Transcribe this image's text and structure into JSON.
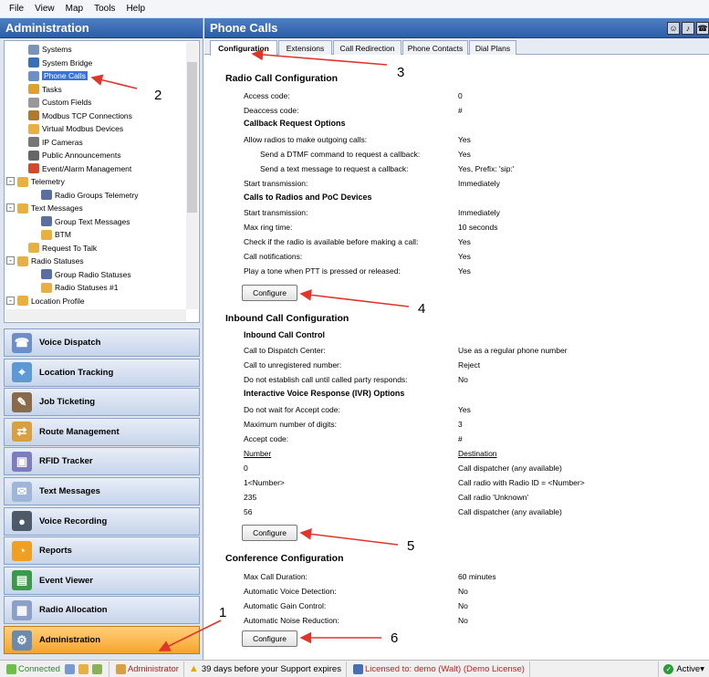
{
  "menu": [
    "File",
    "View",
    "Map",
    "Tools",
    "Help"
  ],
  "left_header": "Administration",
  "tree": [
    {
      "label": "Systems",
      "icon": "systems-icon",
      "color": "#7a93b8",
      "indent": 1
    },
    {
      "label": "System Bridge",
      "icon": "bridge-icon",
      "color": "#3a6fb5",
      "indent": 1
    },
    {
      "label": "Phone Calls",
      "icon": "phone-calls-icon",
      "color": "#6d8fc7",
      "indent": 1,
      "selected": true
    },
    {
      "label": "Tasks",
      "icon": "tasks-icon",
      "color": "#e0a030",
      "indent": 1
    },
    {
      "label": "Custom Fields",
      "icon": "custom-fields-icon",
      "color": "#999",
      "indent": 1
    },
    {
      "label": "Modbus TCP Connections",
      "icon": "modbus-icon",
      "color": "#b07a2a",
      "indent": 1
    },
    {
      "label": "Virtual Modbus Devices",
      "icon": "virtual-modbus-icon",
      "color": "#e8b040",
      "indent": 1
    },
    {
      "label": "IP Cameras",
      "icon": "camera-icon",
      "color": "#777",
      "indent": 1
    },
    {
      "label": "Public Announcements",
      "icon": "speaker-icon",
      "color": "#666",
      "indent": 1
    },
    {
      "label": "Event/Alarm Management",
      "icon": "alarm-icon",
      "color": "#d24a2a",
      "indent": 1
    },
    {
      "label": "Telemetry",
      "icon": "folder-icon",
      "color": "#e8b040",
      "indent": 0,
      "expander": "-"
    },
    {
      "label": "Radio Groups Telemetry",
      "icon": "table-icon",
      "color": "#5a6fa0",
      "indent": 2
    },
    {
      "label": "Text Messages",
      "icon": "folder-icon",
      "color": "#e8b040",
      "indent": 0,
      "expander": "-"
    },
    {
      "label": "Group Text Messages",
      "icon": "table-icon",
      "color": "#5a6fa0",
      "indent": 2
    },
    {
      "label": "BTM",
      "icon": "folder-icon",
      "color": "#e8b040",
      "indent": 2
    },
    {
      "label": "Request To Talk",
      "icon": "folder-icon",
      "color": "#e8b040",
      "indent": 1
    },
    {
      "label": "Radio Statuses",
      "icon": "folder-icon",
      "color": "#e8b040",
      "indent": 0,
      "expander": "-"
    },
    {
      "label": "Group Radio Statuses",
      "icon": "table-icon",
      "color": "#5a6fa0",
      "indent": 2
    },
    {
      "label": "Radio Statuses #1",
      "icon": "folder-icon",
      "color": "#e8b040",
      "indent": 2
    },
    {
      "label": "Location Profile",
      "icon": "folder-icon",
      "color": "#e8b040",
      "indent": 0,
      "expander": "-"
    }
  ],
  "nav": [
    {
      "label": "Voice Dispatch",
      "icon": "voice-dispatch-icon",
      "color": "#6d8fc7",
      "glyph": "☎"
    },
    {
      "label": "Location Tracking",
      "icon": "location-tracking-icon",
      "color": "#5c9ad6",
      "glyph": "⌖"
    },
    {
      "label": "Job Ticketing",
      "icon": "job-ticketing-icon",
      "color": "#8a6a4a",
      "glyph": "✎"
    },
    {
      "label": "Route Management",
      "icon": "route-management-icon",
      "color": "#d9a040",
      "glyph": "⇄"
    },
    {
      "label": "RFID Tracker",
      "icon": "rfid-icon",
      "color": "#7c7cbf",
      "glyph": "▣"
    },
    {
      "label": "Text Messages",
      "icon": "text-messages-icon",
      "color": "#9fb6d8",
      "glyph": "✉"
    },
    {
      "label": "Voice Recording",
      "icon": "voice-recording-icon",
      "color": "#4c5a6a",
      "glyph": "●"
    },
    {
      "label": "Reports",
      "icon": "reports-icon",
      "color": "#f0a020",
      "glyph": "◔"
    },
    {
      "label": "Event Viewer",
      "icon": "event-viewer-icon",
      "color": "#3a9a4a",
      "glyph": "▤"
    },
    {
      "label": "Radio Allocation",
      "icon": "radio-allocation-icon",
      "color": "#8aa0c8",
      "glyph": "▦"
    },
    {
      "label": "Administration",
      "icon": "administration-icon",
      "color": "#6a8ab0",
      "glyph": "⚙",
      "active": true
    }
  ],
  "right_header": "Phone Calls",
  "tabs": [
    "Configuration",
    "Extensions",
    "Call Redirection",
    "Phone Contacts",
    "Dial Plans"
  ],
  "radio": {
    "title": "Radio Call Configuration",
    "access_label": "Access code:",
    "access_value": "0",
    "deaccess_label": "Deaccess code:",
    "deaccess_value": "#",
    "callback_title": "Callback Request Options",
    "allow_label": "Allow radios to make outgoing calls:",
    "allow_value": "Yes",
    "dtmf_label": "Send a DTMF command to request a callback:",
    "dtmf_value": "Yes",
    "text_label": "Send a text message to request a callback:",
    "text_value": "Yes, Prefix: 'sip:'",
    "start_label": "Start transmission:",
    "start_value": "Immediately",
    "calls_title": "Calls to Radios and PoC Devices",
    "start2_label": "Start transmission:",
    "start2_value": "Immediately",
    "ring_label": "Max ring time:",
    "ring_value": "10 seconds",
    "check_label": "Check if the radio is available before making a call:",
    "check_value": "Yes",
    "notif_label": "Call notifications:",
    "notif_value": "Yes",
    "tone_label": "Play a tone when PTT is pressed or released:",
    "tone_value": "Yes"
  },
  "inbound": {
    "title": "Inbound Call Configuration",
    "control_title": "Inbound Call Control",
    "dispatch_label": "Call to Dispatch Center:",
    "dispatch_value": "Use as a regular phone number",
    "unreg_label": "Call to unregistered number:",
    "unreg_value": "Reject",
    "establish_label": "Do not establish call until called party responds:",
    "establish_value": "No",
    "ivr_title": "Interactive Voice Response (IVR) Options",
    "wait_label": "Do not wait for Accept code:",
    "wait_value": "Yes",
    "digits_label": "Maximum number of digits:",
    "digits_value": "3",
    "accept_label": "Accept code:",
    "accept_value": "#",
    "col_number": "Number",
    "col_destination": "Destination",
    "rows": [
      {
        "number": "0",
        "destination": "Call dispatcher (any available)"
      },
      {
        "number": "1<Number>",
        "destination": "Call radio with Radio ID = <Number>"
      },
      {
        "number": "235",
        "destination": "Call radio 'Unknown'"
      },
      {
        "number": "56",
        "destination": "Call dispatcher (any available)"
      }
    ]
  },
  "conference": {
    "title": "Conference Configuration",
    "max_label": "Max Call Duration:",
    "max_value": "60 minutes",
    "avd_label": "Automatic Voice Detection:",
    "avd_value": "No",
    "agc_label": "Automatic Gain Control:",
    "agc_value": "No",
    "anr_label": "Automatic Noise Reduction:",
    "anr_value": "No"
  },
  "configure_label": "Configure",
  "annotations": [
    "1",
    "2",
    "3",
    "4",
    "5",
    "6"
  ],
  "status": {
    "connected": "Connected",
    "user": "Administrator",
    "support": "39 days before your Support expires",
    "license": "Licensed to: demo (Walt) (Demo License)",
    "active": "Active"
  }
}
